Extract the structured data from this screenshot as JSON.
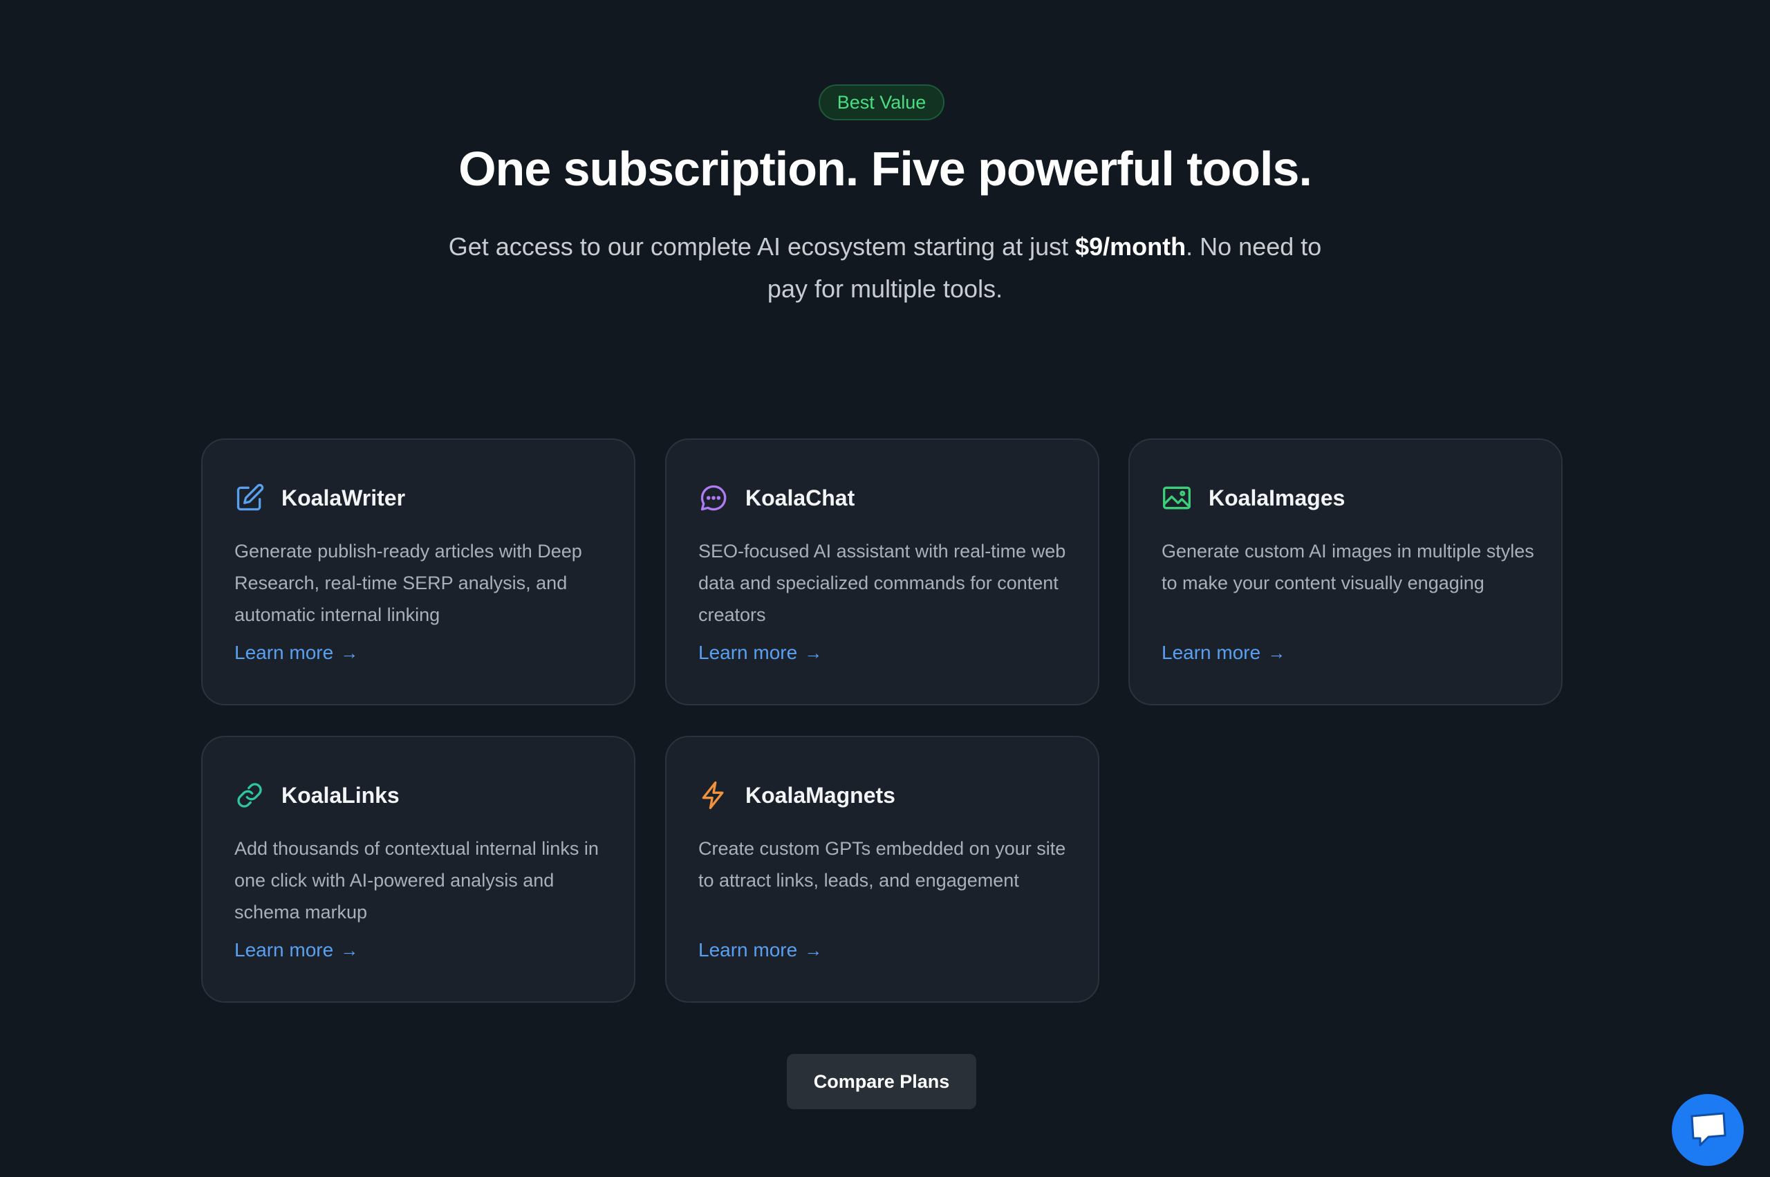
{
  "hero": {
    "badge": "Best Value",
    "title": "One subscription. Five powerful tools.",
    "subtitle_before": "Get access to our complete AI ecosystem starting at just ",
    "subtitle_price": "$9/month",
    "subtitle_after": ". No need to pay for multiple tools."
  },
  "cards": [
    {
      "title": "KoalaWriter",
      "icon": "pencil-icon",
      "icon_color": "#5aa0f0",
      "description": "Generate publish-ready articles with Deep Research, real-time SERP analysis, and automatic internal linking",
      "link": "Learn more"
    },
    {
      "title": "KoalaChat",
      "icon": "chat-icon",
      "icon_color": "#b07cf5",
      "description": "SEO-focused AI assistant with real-time web data and specialized commands for content creators",
      "link": "Learn more"
    },
    {
      "title": "KoalaImages",
      "icon": "image-icon",
      "icon_color": "#3ccf7a",
      "description": "Generate custom AI images in multiple styles to make your content visually engaging",
      "link": "Learn more"
    },
    {
      "title": "KoalaLinks",
      "icon": "link-icon",
      "icon_color": "#2dc6a0",
      "description": "Add thousands of contextual internal links in one click with AI-powered analysis and schema markup",
      "link": "Learn more"
    },
    {
      "title": "KoalaMagnets",
      "icon": "lightning-icon",
      "icon_color": "#f2923a",
      "description": "Create custom GPTs embedded on your site to attract links, leads, and engagement",
      "link": "Learn more"
    }
  ],
  "compare_button": "Compare Plans",
  "chat_widget": {
    "icon": "chat-bubble-icon",
    "color": "#1c7af2"
  }
}
